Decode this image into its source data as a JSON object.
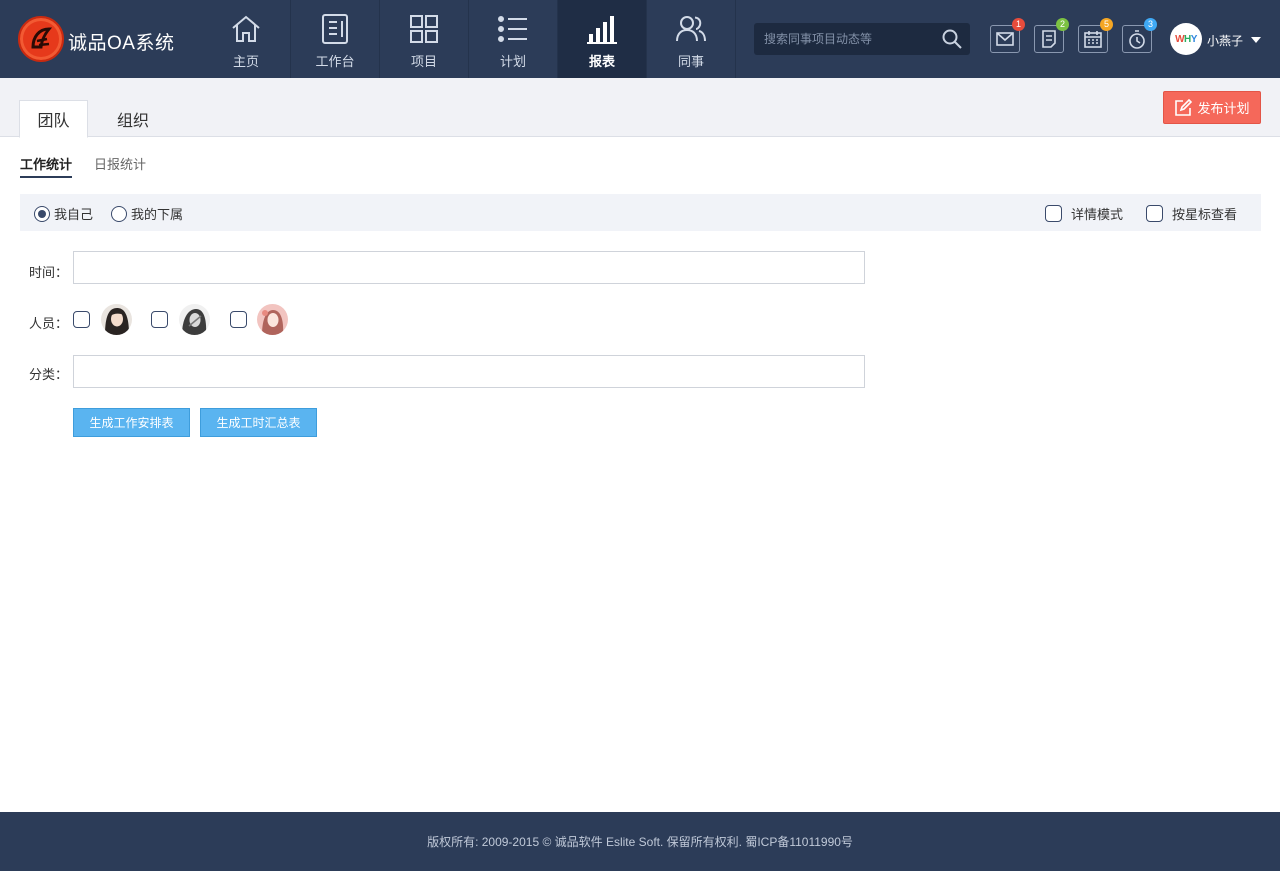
{
  "app": {
    "brand": "诚品OA系统"
  },
  "nav": {
    "items": [
      {
        "label": "主页",
        "icon": "home-icon"
      },
      {
        "label": "工作台",
        "icon": "workbench-icon"
      },
      {
        "label": "项目",
        "icon": "grid-icon"
      },
      {
        "label": "计划",
        "icon": "list-icon"
      },
      {
        "label": "报表",
        "icon": "bar-chart-icon",
        "active": true
      },
      {
        "label": "同事",
        "icon": "users-icon"
      }
    ]
  },
  "search": {
    "placeholder": "搜索同事项目动态等"
  },
  "toolbar": {
    "mail": {
      "icon": "mail-icon",
      "badge": "1",
      "color": "#e74c3c"
    },
    "notes": {
      "icon": "note-icon",
      "badge": "2",
      "color": "#7cc242"
    },
    "calendar": {
      "icon": "calendar-icon",
      "badge": "5",
      "color": "#f5a623"
    },
    "timer": {
      "icon": "timer-icon",
      "badge": "3",
      "color": "#3fa9f5"
    }
  },
  "user": {
    "avatar_text": [
      "W",
      "H",
      "Y"
    ],
    "name": "小燕子"
  },
  "tabs": [
    {
      "label": "团队",
      "active": true
    },
    {
      "label": "组织"
    }
  ],
  "publish_button": "发布计划",
  "subtabs": [
    {
      "label": "工作统计",
      "active": true
    },
    {
      "label": "日报统计"
    }
  ],
  "filter": {
    "scope": [
      {
        "label": "我自己",
        "checked": true
      },
      {
        "label": "我的下属",
        "checked": false
      }
    ],
    "options": [
      {
        "label": "详情模式"
      },
      {
        "label": "按星标查看"
      }
    ]
  },
  "form": {
    "time_label": "时间：",
    "time_value": "",
    "people_label": "人员：",
    "people_count": 3,
    "category_label": "分类：",
    "category_value": "",
    "btn_schedule": "生成工作安排表",
    "btn_hours": "生成工时汇总表"
  },
  "footer": "版权所有: 2009-2015 © 诚品软件 Eslite Soft. 保留所有权利. 蜀ICP备11011990号"
}
